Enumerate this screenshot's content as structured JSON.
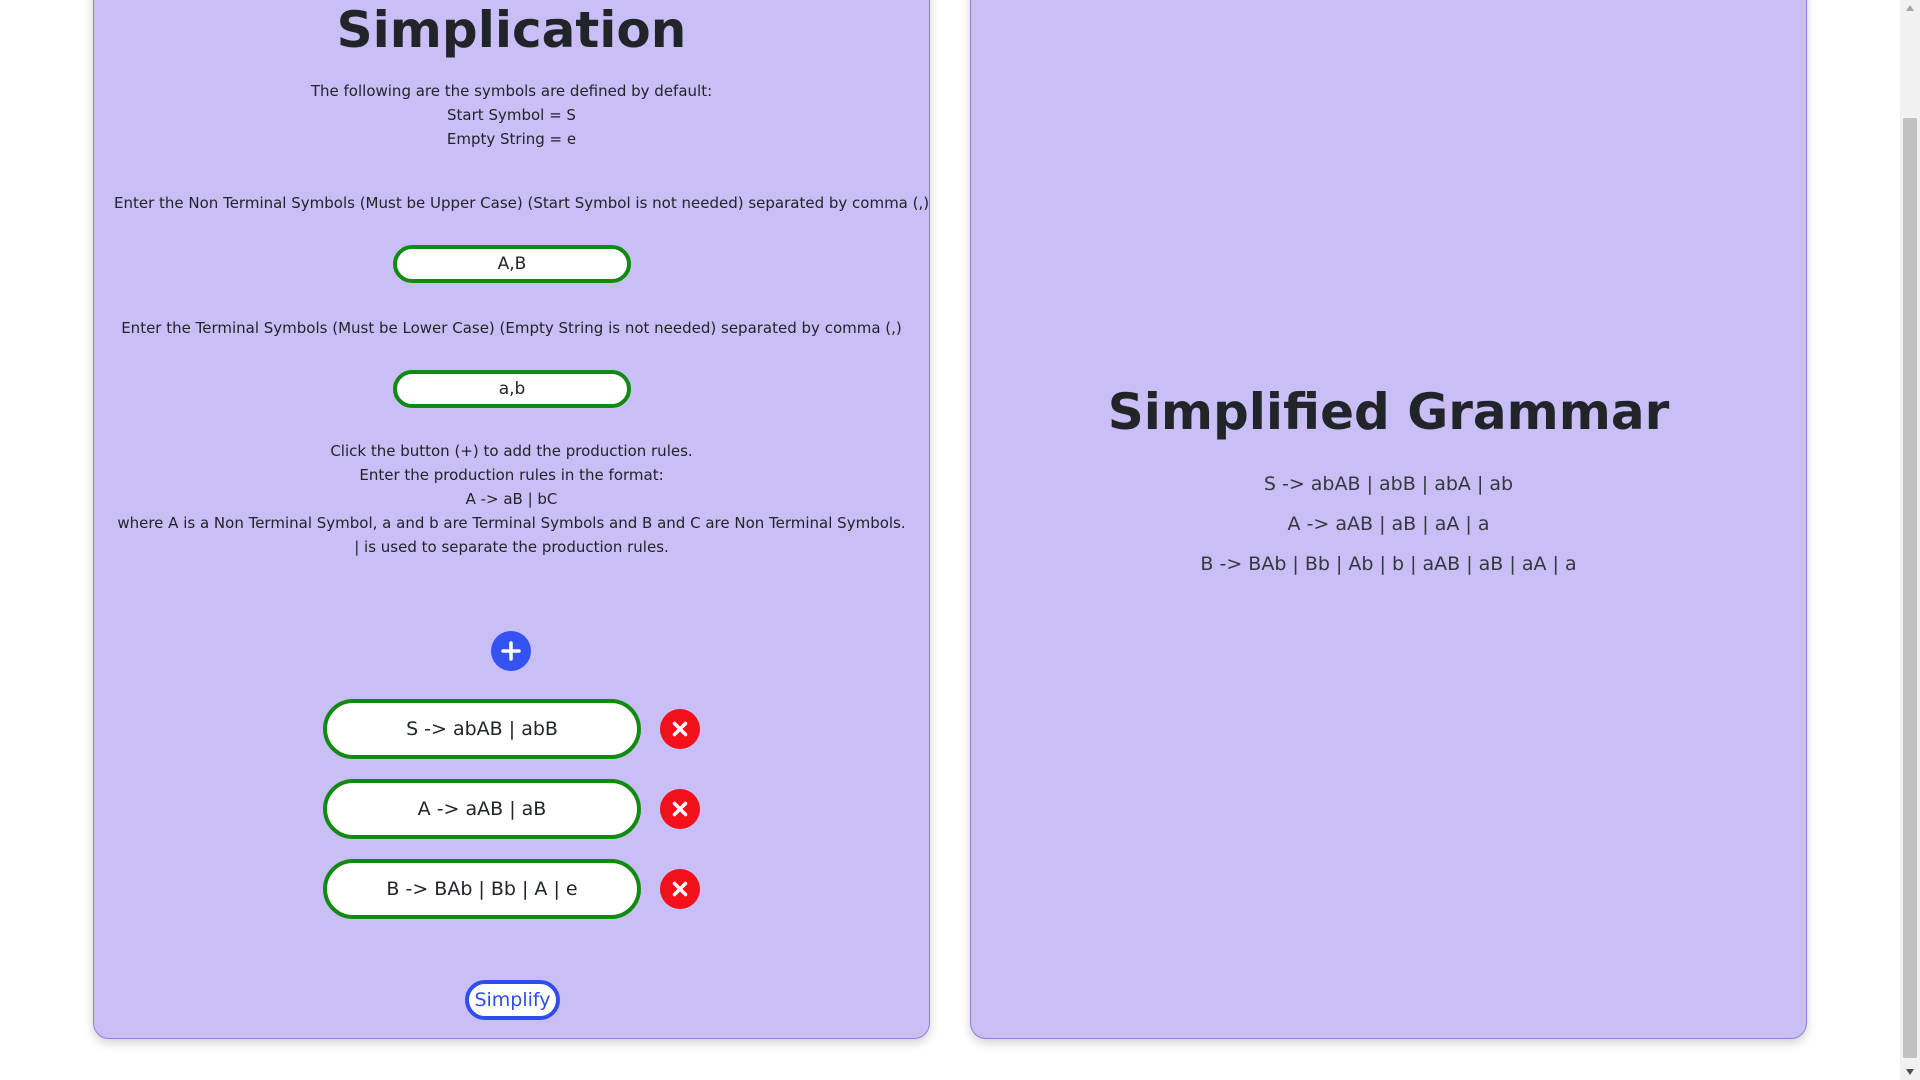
{
  "left_panel": {
    "title": "Simplication",
    "defaults": {
      "heading": "The following are the symbols are defined by default:",
      "start_symbol": "Start Symbol = S",
      "empty_string": "Empty String = e"
    },
    "nonterminal": {
      "prompt": "Enter the Non Terminal Symbols (Must be Upper Case) (Start Symbol is not needed) separated by comma (,)",
      "value": "A,B"
    },
    "terminal": {
      "prompt": "Enter the Terminal Symbols (Must be Lower Case) (Empty String is not needed) separated by comma (,)",
      "value": "a,b"
    },
    "instructions": {
      "line1": "Click the button (+) to add the production rules.",
      "line2": "Enter the production rules in the format:",
      "line3": "A -> aB | bC",
      "line4": "where A is a Non Terminal Symbol, a and b are Terminal Symbols and B and C are Non Terminal Symbols. | is used to separate the production rules."
    },
    "add_icon": "plus-icon",
    "rules": [
      {
        "value": "S -> abAB | abB",
        "delete_icon": "close-icon"
      },
      {
        "value": "A -> aAB | aB",
        "delete_icon": "close-icon"
      },
      {
        "value": "B -> BAb | Bb | A | e",
        "delete_icon": "close-icon"
      }
    ],
    "simplify_label": "Simplify"
  },
  "right_panel": {
    "title": "Simplified Grammar",
    "results": [
      "S -> abAB | abB | abA | ab",
      "A -> aAB | aB | aA | a",
      "B -> BAb | Bb | Ab | b | aAB | aB | aA | a"
    ]
  },
  "colors": {
    "panel_background": "#c9bef5",
    "input_border": "#118a11",
    "add_button": "#3553f5",
    "delete_button": "#f2101b",
    "simplify_border": "#2e4df0"
  }
}
